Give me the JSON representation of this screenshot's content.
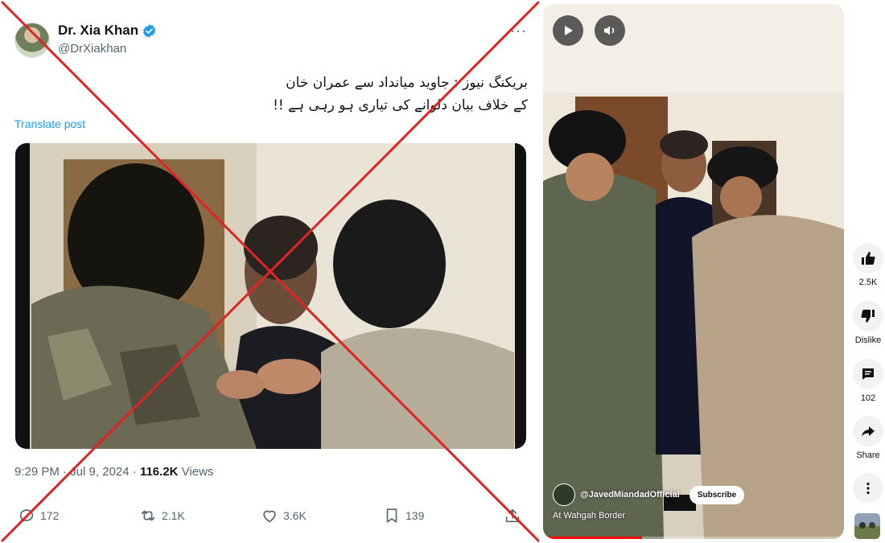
{
  "tweet": {
    "author_name": "Dr. Xia Khan",
    "handle": "@DrXiakhan",
    "text_line1": "بریکنگ نیوز : جاوید میانداد سے عمران خان",
    "text_line2": "کے خلاف بیان دلوانے کی تیاری ہو رہی ہے !!",
    "translate_label": "Translate post",
    "time": "9:29 PM",
    "date": "Jul 9, 2024",
    "views_count": "116.2K",
    "views_label": "Views",
    "replies": "172",
    "reposts": "2.1K",
    "likes": "3.6K",
    "bookmarks": "139",
    "more_icon": "more-dots-icon",
    "verified_color": "#1d9bf0"
  },
  "overlay": {
    "cross_color": "#e02424"
  },
  "video": {
    "channel": "@JavedMiandadOfficial",
    "subscribe_label": "Subscribe",
    "caption": "At Wahgah Border",
    "progress": 0.33
  },
  "rail": {
    "like_count": "2.5K",
    "dislike_label": "Dislike",
    "comment_count": "102",
    "share_label": "Share"
  }
}
